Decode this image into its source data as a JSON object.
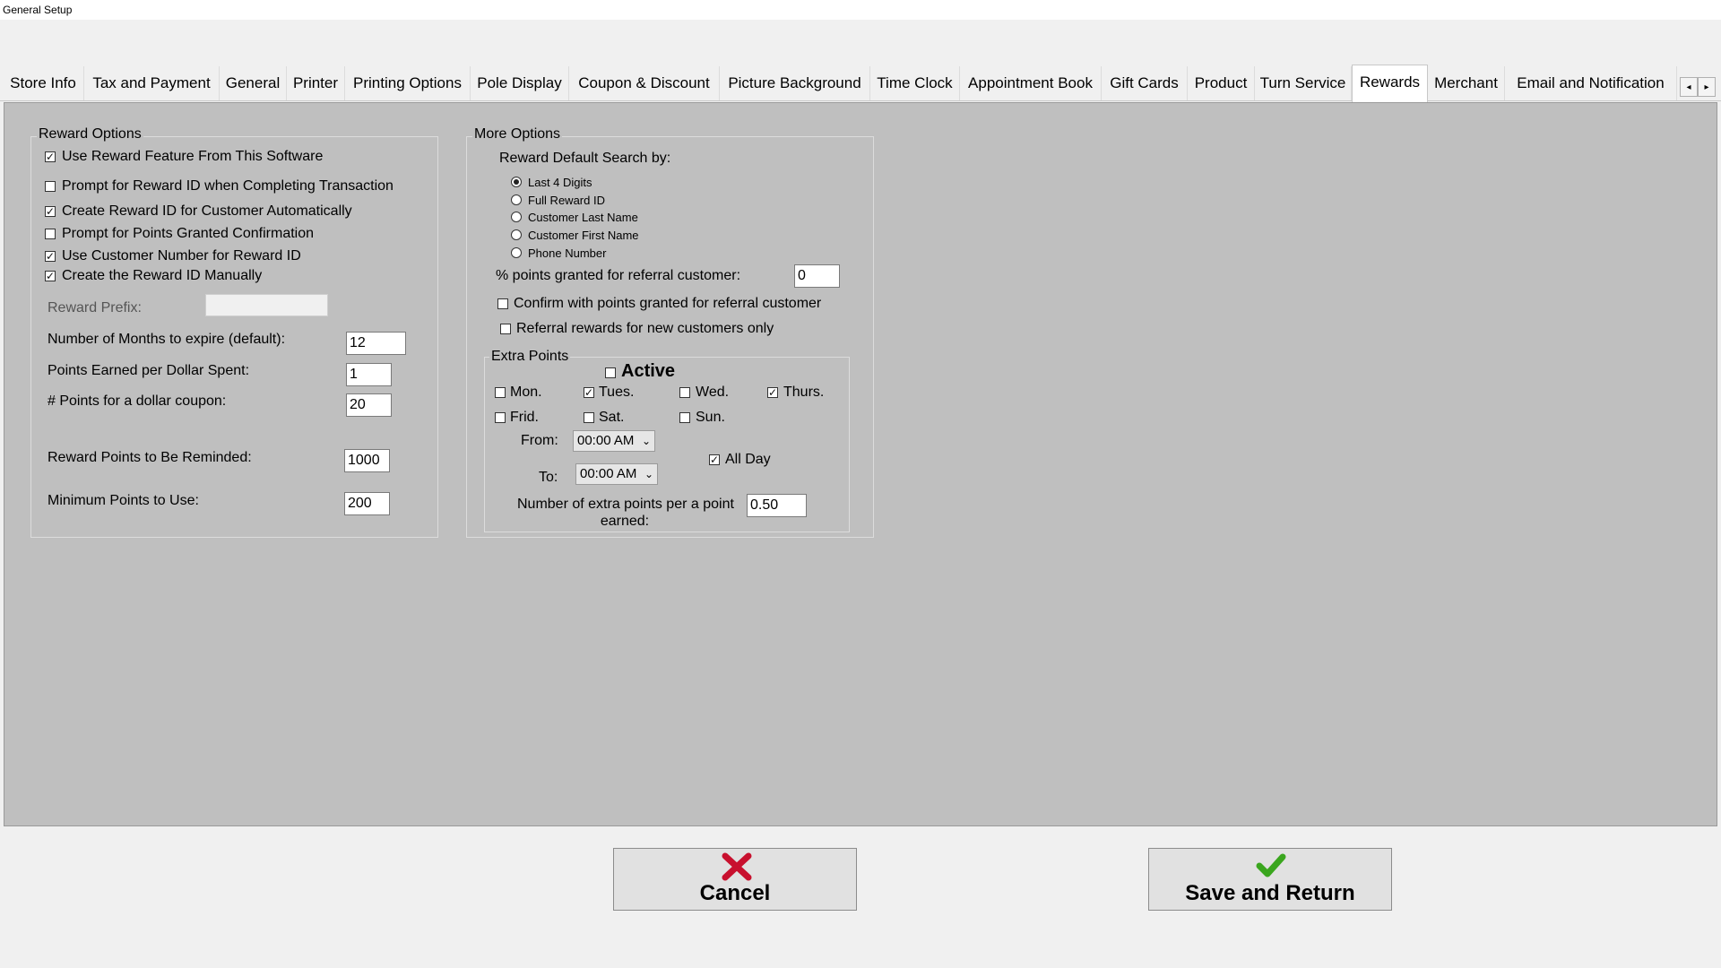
{
  "window": {
    "title": "General Setup"
  },
  "tabs": [
    {
      "label": "Store Info",
      "active": false
    },
    {
      "label": "Tax and Payment",
      "active": false
    },
    {
      "label": "General",
      "active": false
    },
    {
      "label": "Printer",
      "active": false
    },
    {
      "label": "Printing Options",
      "active": false
    },
    {
      "label": "Pole Display",
      "active": false
    },
    {
      "label": "Coupon & Discount",
      "active": false
    },
    {
      "label": "Picture Background",
      "active": false
    },
    {
      "label": "Time Clock",
      "active": false
    },
    {
      "label": "Appointment Book",
      "active": false
    },
    {
      "label": "Gift Cards",
      "active": false
    },
    {
      "label": "Product",
      "active": false
    },
    {
      "label": "Turn Service",
      "active": false
    },
    {
      "label": "Rewards",
      "active": true
    },
    {
      "label": "Merchant",
      "active": false
    },
    {
      "label": "Email and Notification",
      "active": false
    }
  ],
  "tab_scroll": {
    "left": "◂",
    "right": "▸"
  },
  "reward_options": {
    "legend": "Reward Options",
    "checkboxes": [
      {
        "label": "Use Reward Feature From This Software",
        "checked": true
      },
      {
        "label": "Prompt for Reward ID when Completing Transaction",
        "checked": false
      },
      {
        "label": "Create Reward ID for Customer Automatically",
        "checked": true
      },
      {
        "label": "Prompt for Points Granted Confirmation",
        "checked": false
      },
      {
        "label": "Use Customer Number for Reward ID",
        "checked": true
      },
      {
        "label": "Create the Reward ID Manually",
        "checked": true
      }
    ],
    "prefix_label": "Reward Prefix:",
    "prefix_value": "",
    "months_label": "Number of Months to expire (default):",
    "months_value": "12",
    "points_per_dollar_label": "Points Earned per Dollar Spent:",
    "points_per_dollar_value": "1",
    "points_coupon_label": "# Points for a dollar coupon:",
    "points_coupon_value": "20",
    "reminded_label": "Reward Points to Be Reminded:",
    "reminded_value": "1000",
    "min_points_label": "Minimum Points to Use:",
    "min_points_value": "200"
  },
  "more_options": {
    "legend": "More Options",
    "search_label": "Reward Default Search by:",
    "search_options": [
      {
        "label": "Last 4 Digits",
        "selected": true
      },
      {
        "label": "Full Reward ID",
        "selected": false
      },
      {
        "label": "Customer Last Name",
        "selected": false
      },
      {
        "label": "Customer First Name",
        "selected": false
      },
      {
        "label": "Phone Number",
        "selected": false
      }
    ],
    "referral_pct_label": "% points granted for referral customer:",
    "referral_pct_value": "0",
    "confirm_referral": {
      "label": "Confirm with points granted for referral customer",
      "checked": false
    },
    "referral_new_only": {
      "label": "Referral rewards for new customers only",
      "checked": false
    }
  },
  "extra_points": {
    "legend": "Extra Points",
    "active": {
      "label": "Active",
      "checked": false
    },
    "days": [
      {
        "label": "Mon.",
        "checked": false
      },
      {
        "label": "Tues.",
        "checked": true
      },
      {
        "label": "Wed.",
        "checked": false
      },
      {
        "label": "Thurs.",
        "checked": true
      },
      {
        "label": "Frid.",
        "checked": false
      },
      {
        "label": "Sat.",
        "checked": false
      },
      {
        "label": "Sun.",
        "checked": false
      }
    ],
    "from_label": "From:",
    "from_value": "00:00 AM",
    "to_label": "To:",
    "to_value": "00:00 AM",
    "all_day": {
      "label": "All Day",
      "checked": true
    },
    "extra_label_line1": "Number of extra points per a point",
    "extra_label_line2": "earned:",
    "extra_value": "0.50"
  },
  "buttons": {
    "cancel": "Cancel",
    "save": "Save and Return"
  },
  "colors": {
    "panel": "#bfbfbf",
    "window": "#f0f0f0",
    "cancel_icon": "#c8102e",
    "save_icon": "#3aa61e"
  }
}
